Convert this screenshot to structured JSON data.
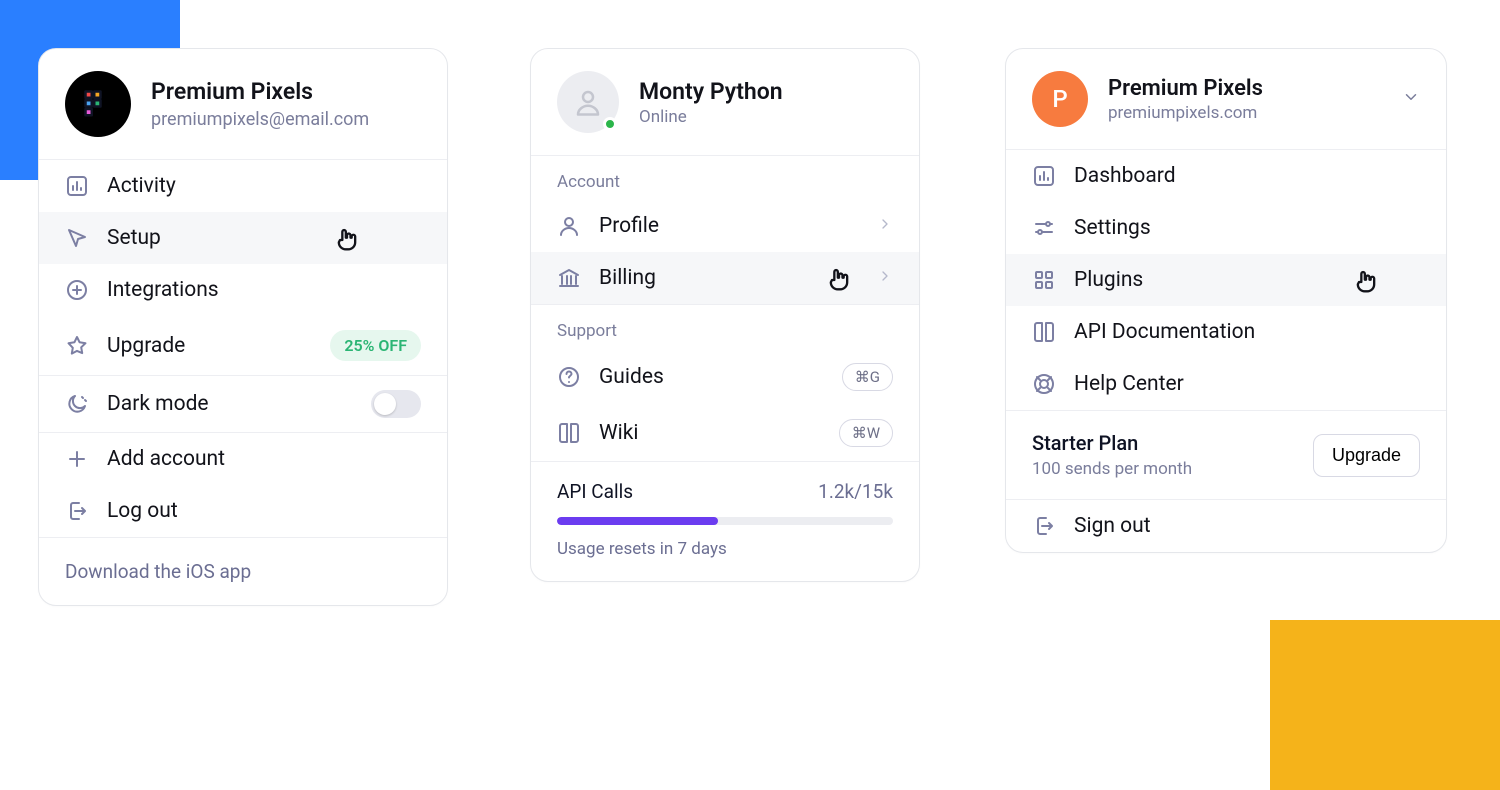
{
  "panel1": {
    "title": "Premium Pixels",
    "subtitle": "premiumpixels@email.com",
    "items": [
      {
        "label": "Activity"
      },
      {
        "label": "Setup"
      },
      {
        "label": "Integrations"
      },
      {
        "label": "Upgrade",
        "badge": "25% OFF"
      }
    ],
    "dark_mode_label": "Dark mode",
    "add_account": "Add account",
    "log_out": "Log out",
    "footer": "Download the iOS app"
  },
  "panel2": {
    "title": "Monty Python",
    "status": "Online",
    "account_label": "Account",
    "support_label": "Support",
    "account_items": [
      {
        "label": "Profile"
      },
      {
        "label": "Billing"
      }
    ],
    "support_items": [
      {
        "label": "Guides",
        "kbd": "⌘G"
      },
      {
        "label": "Wiki",
        "kbd": "⌘W"
      }
    ],
    "usage_title": "API Calls",
    "usage_count": "1.2k/15k",
    "usage_note": "Usage resets in 7 days"
  },
  "panel3": {
    "title": "Premium Pixels",
    "subtitle": "premiumpixels.com",
    "avatar_letter": "P",
    "items": [
      {
        "label": "Dashboard"
      },
      {
        "label": "Settings"
      },
      {
        "label": "Plugins"
      },
      {
        "label": "API Documentation"
      },
      {
        "label": "Help Center"
      }
    ],
    "plan_title": "Starter Plan",
    "plan_sub": "100 sends per month",
    "upgrade_btn": "Upgrade",
    "sign_out": "Sign out"
  }
}
